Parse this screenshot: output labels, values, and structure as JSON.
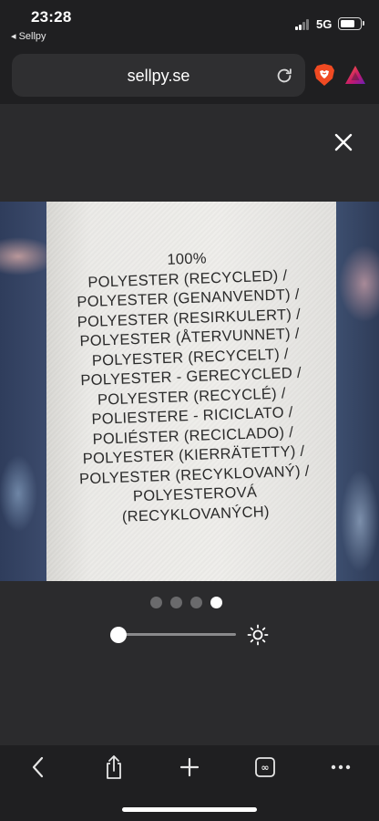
{
  "status_bar": {
    "time": "23:28",
    "back_app": "◂ Sellpy",
    "network": "5G",
    "signal_bars": 2,
    "battery_level": 0.75
  },
  "browser": {
    "url": "sellpy.se",
    "reload_icon": "reload-icon",
    "shields_icon": "brave-shields-icon",
    "rewards_icon": "brave-rewards-icon"
  },
  "lightbox": {
    "close_icon": "close-icon",
    "image_description_lines": [
      "100%",
      "POLYESTER (RECYCLED) /",
      "POLYESTER (GENANVENDT) /",
      "POLYESTER (RESIRKULERT) /",
      "POLYESTER (ÅTERVUNNET) /",
      "POLYESTER (RECYCELT) /",
      "POLYESTER - GERECYCLED /",
      "POLYESTER (RECYCLÉ) /",
      "POLIESTERE - RICICLATO /",
      "POLIÉSTER (RECICLADO) /",
      "POLYESTER (KIERRÄTETTY) /",
      "POLYESTER (RECYKLOVANÝ) /",
      "POLYESTEROVÁ",
      "(RECYKLOVANÝCH)"
    ],
    "pager": {
      "total": 4,
      "current": 4
    },
    "zoom": {
      "level": 0.0,
      "brightness_icon": "brightness-icon"
    }
  },
  "toolbar": {
    "items": [
      {
        "name": "back-button",
        "icon": "chevron-left-icon"
      },
      {
        "name": "share-button",
        "icon": "share-icon"
      },
      {
        "name": "new-tab-button",
        "icon": "plus-icon"
      },
      {
        "name": "tabs-button",
        "icon": "tabs-icon"
      },
      {
        "name": "menu-button",
        "icon": "more-icon"
      }
    ]
  }
}
